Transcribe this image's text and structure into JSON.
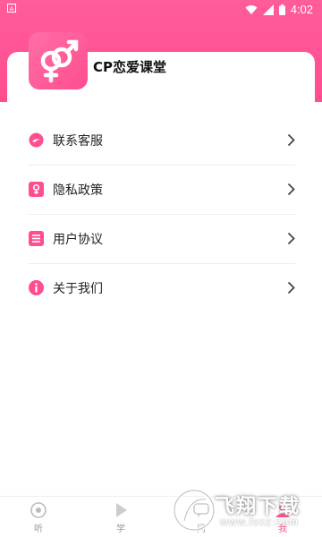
{
  "status_bar": {
    "time": "4:02"
  },
  "profile": {
    "app_name": "CP恋爱课堂"
  },
  "menu": {
    "items": [
      {
        "label": "联系客服",
        "icon": "chat-bubble-icon"
      },
      {
        "label": "隐私政策",
        "icon": "privacy-icon"
      },
      {
        "label": "用户协议",
        "icon": "document-icon"
      },
      {
        "label": "关于我们",
        "icon": "info-icon"
      }
    ]
  },
  "bottom_nav": {
    "items": [
      {
        "label": "听",
        "icon": "listen-icon"
      },
      {
        "label": "学",
        "icon": "play-icon"
      },
      {
        "label": "问",
        "icon": "chat-icon"
      },
      {
        "label": "我",
        "icon": "user-icon",
        "active": true
      }
    ]
  },
  "watermark": {
    "text": "飞翔下载",
    "url": "www.fxxz.com"
  },
  "colors": {
    "accent": "#ff4d90",
    "text": "#222222",
    "muted": "#999999"
  }
}
